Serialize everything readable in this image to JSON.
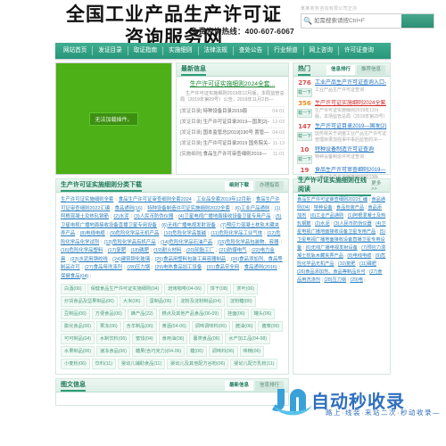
{
  "header": {
    "site_title": "全国工业产品生产许可证咨询服务网",
    "hotline": "免费咨询热线：400-607-6067",
    "corp_line": "某某商务咨询有限公司正办",
    "search_placeholder": "如需搜索请按Ctrl+F",
    "search_button": "搜索",
    "search_icon": "search-icon"
  },
  "nav": {
    "items": [
      "网站首页",
      "发证目录",
      "取证指南",
      "实施细则",
      "法律法规",
      "查处公告",
      "行业频道",
      "网上咨询",
      "许可证查询"
    ]
  },
  "plugin": {
    "message": "无法加载插件。"
  },
  "news": {
    "title": "最新信息",
    "tabs": [],
    "lead": {
      "title": "生产许可证实施细则2024全套...",
      "desc": "生产许可证实施细则2019年12月版，本局监管总局（2019年第29号）公告，2019年11月2日—"
    },
    "items": [
      {
        "cat": "[发证目录]",
        "text": "特种设备目录2019版",
        "date": "04-01"
      },
      {
        "cat": "[发证目录]",
        "text": "生产许可证目录2019—国发[2]—",
        "date": "12-03"
      },
      {
        "cat": "[发证目录]",
        "text": "国本监管总[2019]190号  置管—",
        "date": "04-03"
      },
      {
        "cat": "[发证目录]",
        "text": "生产许可证目录2019 国务院关—",
        "date": "11-13"
      },
      {
        "cat": "[实施细则]",
        "text": "食品生产许可审查细则2019—",
        "date": "11-01"
      }
    ]
  },
  "hot": {
    "title": "热门",
    "tabs": [
      {
        "label": "信息排行",
        "active": true
      },
      {
        "label": "推荐信息",
        "active": false
      }
    ],
    "download_label": "载一下",
    "items": [
      {
        "rank": "276",
        "rank_color": "red",
        "title": "工业产品生产许可证查询入口—",
        "title_color": "blue",
        "desc": "工业产品生产许可证查询"
      },
      {
        "rank": "356",
        "rank_color": "orange",
        "title": "生产许可证实施细则2024全套—",
        "title_color": "red",
        "desc": "生产许可证实施细则2019年12月版，本场监管总局（2019年第29号）—"
      },
      {
        "rank": "147",
        "rank_color": "red",
        "title": "生产许可证目录2019—国发[2]—",
        "title_color": "dark",
        "desc": "国务院关于调整工业产品生产许可证管理目录加强事中事后监管的决—"
      },
      {
        "rank": "10",
        "rank_color": "red",
        "title": "特种设备制造许可证查询",
        "title_color": "dark",
        "desc": "特种设备制造许可证查询"
      },
      {
        "rank": "19",
        "rank_color": "red",
        "title": "食品生产许可审查细则2019—",
        "title_color": "dark",
        "desc": "—食品生产许可审查细则2019版"
      }
    ]
  },
  "download_panel": {
    "title": "生产许可证实施细则分类下载",
    "tabs": [
      {
        "label": "细则下载",
        "active": true
      },
      {
        "label": "办理指南",
        "active": false
      }
    ],
    "links": [
      "生产许可证实施细则全套",
      "食品生产许可证审查细则全套2024",
      "工业品全套2019年12月新",
      "食品生产许可证审查细则2022汇编",
      "食品通则(16)",
      "特种设备制造许可证实施细则2022全套",
      "(6)工业产品通则"
    ],
    "numbered_links": [
      "(1)阿根混凝土及热轧钢筋",
      "(2)水泥",
      "(3)人民币防伪仪器",
      "(4)卫星电视广播地面接收设备卫星专用产品",
      "(5)卫星电视广播地面接收设备直播卫星专用设备",
      "(6)无线广播电视发射设备",
      "(7)预应力混凝土枕轨木藏夹弄产品",
      "(8)电线电缆",
      "(9)危险化学品无机产品",
      "(10)危险化学品氯碱",
      "(11)危险化学品工业气体",
      "(12)危险化学品化学试剂",
      "(13)危险化学品有机产品",
      "(14)危险化学品石油产品",
      "(15)危险化学品包装物、容器",
      "(16)危险化学品塑料",
      "(17)复肥",
      "(18)磷肥",
      "(19)耐火材料",
      "(20)轮胎工厂",
      "(21)防爆电气",
      "(22)电力金具",
      "(23)水泥用钢绞线",
      "(24)建筑钢化玻璃",
      "(25)食品用塑料包装工具容器制品",
      "(26)食品添加剂、食品等制品许可",
      "(27)食品用洗涤剂",
      "(28)压力锅",
      "(29)电热食品加工设备",
      "(31)食品安全网",
      "食品通则(2016)",
      "保健食品(04)"
    ],
    "chips": [
      "白酒(06)",
      "保健食品生产许可证实施细则(04)",
      "焙烤咖啡(04-06)",
      "饼干(08)",
      "茶叶(06)",
      "炒货食品及坚果制品(06)",
      "大米(06)",
      "蛋制品(06)",
      "淀粉及淀粉制品(04)",
      "淀粉糖(06)",
      "豆制品(06)",
      "方便食品(06)",
      "蜂产品(22)",
      "糕点及其他产品食品(06-09)",
      "挂面(06)",
      "罐头(06)",
      "膨化食品(06)",
      "果冻(06)",
      "含羊制品(06)",
      "黄酒(04-06)",
      "调味调味料(06)",
      "酱油(06)",
      "酱菜(06)",
      "可可制品(04)",
      "水制饮料(06)",
      "蜜饯(04)",
      "食用油(06)",
      "薯类食品(06)",
      "水产加工品(04-08)",
      "水果制品(06)",
      "速冻食品(06)",
      "糖果(含巧克力)(04-06)",
      "糖(06)",
      "调味料(06)",
      "味精(06)",
      "小麦粉(06)",
      "饮料(11)",
      "婴幼儿辅助食品(11)",
      "婴幼儿及其他配方谷粉(06)",
      "婴幼儿配方乳粉(11)"
    ]
  },
  "read_panel": {
    "title": "生产许可证实施细则在线阅读",
    "more": "更多>>",
    "links": [
      "食品生产许可证审查细则2022汇编",
      "食品通则(04)",
      "特种设备",
      "食品包装产品",
      "食品添加剂",
      "(6)工业产品通则",
      "(1)阿根混凝土及热轧钢筋",
      "(2)水泥",
      "(3)人民币防伪仪器",
      "(4)卫星电视广播地面接收设备卫星专用产品",
      "(5)卫星电视广播地面接收设备直播卫星专用设备",
      "(6)无线广播电视发射设备",
      "(7)预应力混凝土枕轨木藏夹弄产品",
      "(8)电线电缆",
      "(9)危险化学品无机产品",
      "(10)复肥",
      "(11)磷肥",
      "(26)食品添加剂、食品等制品许可",
      "(27)食品用洗涤剂",
      "(28)压力锅",
      "(29)电"
    ]
  },
  "imgtext_panel": {
    "title": "图文信息",
    "tabs": [
      {
        "label": "最新信息",
        "active": true
      },
      {
        "label": "信息排行",
        "active": false
      }
    ]
  },
  "watermark": {
    "text": "自动秒收录",
    "sub": "路上·线装·来站二次·秒动收录—"
  },
  "colors": {
    "brand_green": "#2e9c79",
    "nav_green": "#3fae8f",
    "plugin_green": "#4cb016",
    "link_blue": "#2a7fbf",
    "hot_red": "#e04a4a",
    "hot_orange": "#e88a1f",
    "watermark_blue": "#2e6fbe"
  }
}
